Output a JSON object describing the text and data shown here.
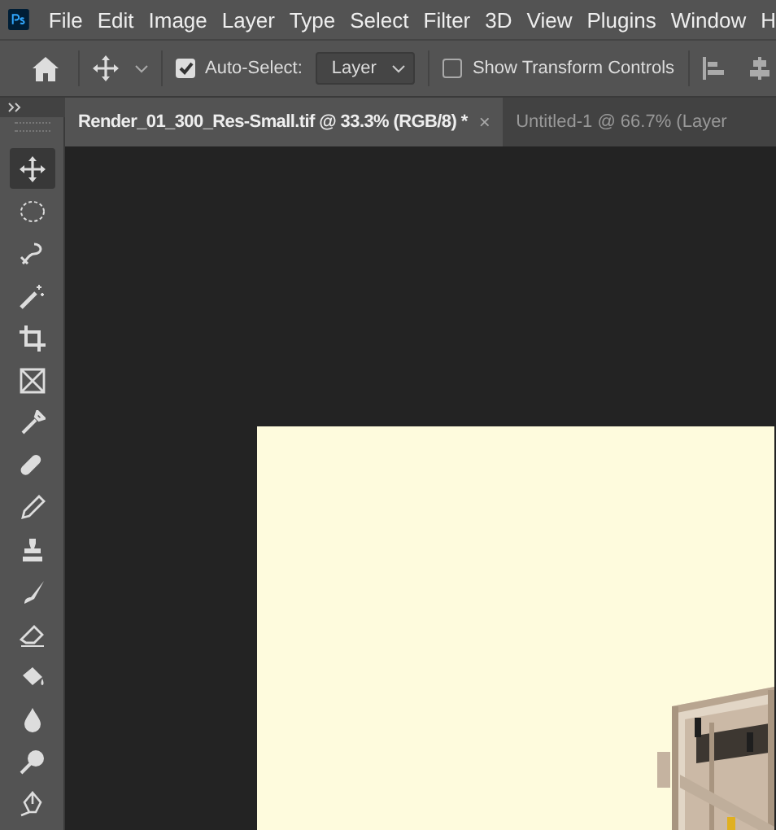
{
  "menu_bar": {
    "items": [
      "File",
      "Edit",
      "Image",
      "Layer",
      "Type",
      "Select",
      "Filter",
      "3D",
      "View",
      "Plugins",
      "Window",
      "H"
    ]
  },
  "options_bar": {
    "auto_select": {
      "label": "Auto-Select:",
      "checked": true
    },
    "target": {
      "value": "Layer"
    },
    "show_transform_controls": {
      "label": "Show Transform Controls",
      "checked": false
    }
  },
  "tabs": [
    {
      "label": "Render_01_300_Res-Small.tif @ 33.3% (RGB/8) *",
      "close": "×",
      "selected": true
    },
    {
      "label": "Untitled-1 @ 66.7% (Layer",
      "selected": false
    }
  ],
  "tools": [
    {
      "selected": true
    },
    {
      "selected": false
    },
    {
      "selected": false
    },
    {
      "selected": false
    },
    {
      "selected": false
    },
    {
      "selected": false
    },
    {
      "selected": false
    },
    {
      "selected": false
    },
    {
      "selected": false
    },
    {
      "selected": false
    },
    {
      "selected": false
    },
    {
      "selected": false
    },
    {
      "selected": false
    },
    {
      "selected": false
    },
    {
      "selected": false
    },
    {
      "selected": false
    }
  ]
}
